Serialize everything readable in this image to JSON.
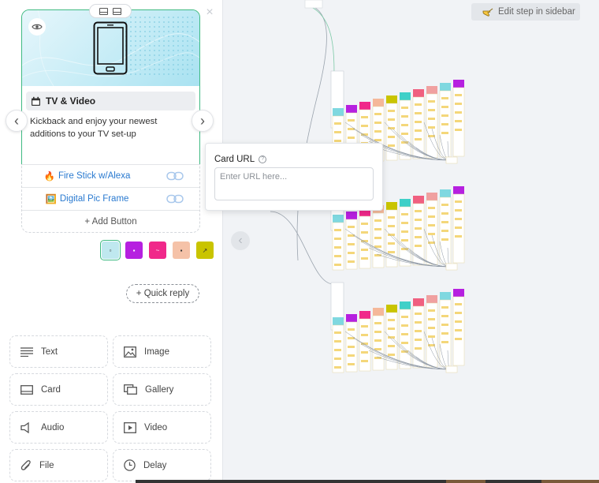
{
  "card": {
    "title": "TV & Video",
    "description": "Kickback and enjoy your newest additions to your TV set-up",
    "buttons": [
      {
        "emoji": "🔥",
        "label": "Fire Stick w/Alexa"
      },
      {
        "emoji": "🖼️",
        "label": "Digital Pic Frame"
      }
    ],
    "add_button_label": "+ Add Button"
  },
  "quick_reply_label": "+ Quick reply",
  "palette": {
    "text": "Text",
    "image": "Image",
    "card": "Card",
    "gallery": "Gallery",
    "audio": "Audio",
    "video": "Video",
    "file": "File",
    "delay": "Delay"
  },
  "popover": {
    "title": "Card URL",
    "placeholder": "Enter URL here..."
  },
  "canvas": {
    "edit_step_label": "Edit step in sidebar"
  },
  "thumbs": [
    {
      "name": "thumb-1",
      "color": "#bfe8ef"
    },
    {
      "name": "thumb-2",
      "color": "#b620e0"
    },
    {
      "name": "thumb-3",
      "color": "#f0288a"
    },
    {
      "name": "thumb-4",
      "color": "#f5c2a8"
    },
    {
      "name": "thumb-5",
      "color": "#c9c400"
    }
  ],
  "colors": {
    "accent": "#3fba82",
    "link": "#2a7ad0"
  }
}
